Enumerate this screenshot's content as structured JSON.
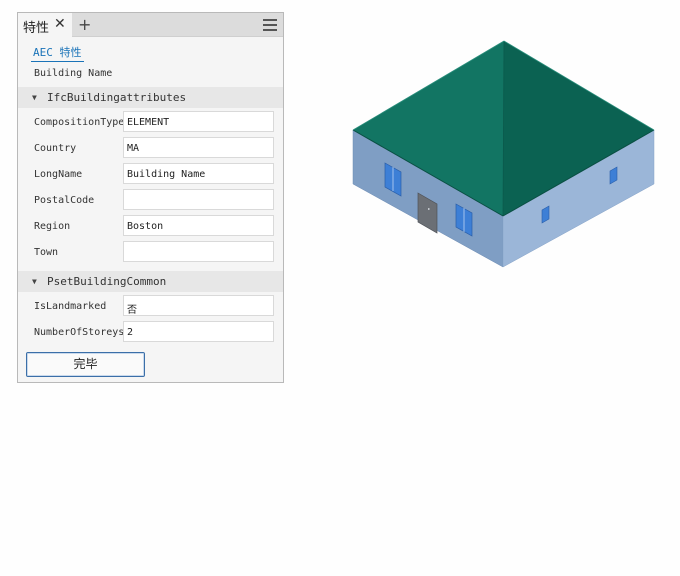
{
  "panel": {
    "tab_label": "特性",
    "close_glyph": "✕",
    "add_glyph": "+",
    "aec_link": "AEC 特性",
    "building_name": "Building Name",
    "sections": [
      {
        "title": "IfcBuildingattributes",
        "rows": [
          {
            "label": "CompositionType",
            "value": "ELEMENT"
          },
          {
            "label": "Country",
            "value": "MA"
          },
          {
            "label": "LongName",
            "value": "Building Name"
          },
          {
            "label": "PostalCode",
            "value": ""
          },
          {
            "label": "Region",
            "value": "Boston"
          },
          {
            "label": "Town",
            "value": ""
          }
        ]
      },
      {
        "title": "PsetBuildingCommon",
        "rows": [
          {
            "label": "IsLandmarked",
            "value": "否"
          },
          {
            "label": "NumberOfStoreys",
            "value": "2"
          }
        ]
      }
    ],
    "done_button": "完毕"
  },
  "colors": {
    "roof": "#0e6b5c",
    "wall_left": "#7f9ec4",
    "wall_right": "#9bb6d8",
    "window": "#3d7fd6",
    "door": "#6b6f75",
    "link": "#1a73b8"
  },
  "icons": [
    "close-icon",
    "add-icon",
    "menu-icon",
    "collapse-arrow-icon"
  ]
}
